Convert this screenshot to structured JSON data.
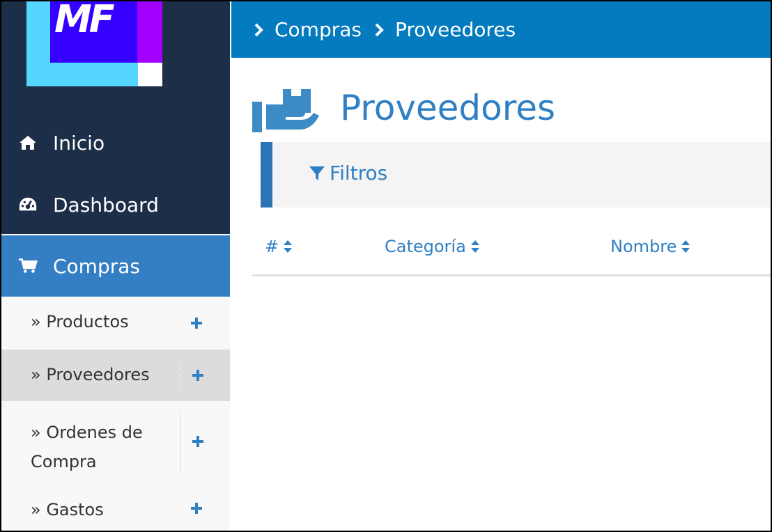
{
  "logo": {
    "text": "MF"
  },
  "sidebar": {
    "nav": [
      {
        "label": "Inicio",
        "icon": "home-icon"
      },
      {
        "label": "Dashboard",
        "icon": "dashboard-icon"
      },
      {
        "label": "Compras",
        "icon": "shopping-cart-icon",
        "active": true
      }
    ],
    "sub_items": [
      {
        "label": "» Productos",
        "action_icon": "plus-icon"
      },
      {
        "label": "» Proveedores",
        "action_icon": "plus-icon",
        "selected": true
      },
      {
        "label": "» Ordenes de Compra",
        "action_icon": "plus-icon"
      },
      {
        "label": "» Gastos",
        "action_icon": "plus-icon"
      }
    ]
  },
  "breadcrumb": {
    "items": [
      "Compras",
      "Proveedores"
    ],
    "icon": "chevron-right-icon"
  },
  "page": {
    "title": "Proveedores",
    "icon": "hand-holding-box-icon"
  },
  "filters": {
    "label": "Filtros",
    "icon": "filter-icon"
  },
  "table": {
    "columns": [
      {
        "label": "#",
        "sort_icon": "sort-icon"
      },
      {
        "label": "Categoría",
        "sort_icon": "sort-icon"
      },
      {
        "label": "Nombre",
        "sort_icon": "sort-icon"
      }
    ]
  },
  "colors": {
    "sidebar_dark": "#1c2e48",
    "active_nav": "#347ec4",
    "topbar": "#047bbf",
    "accent_text": "#2e7fc4",
    "selected_sub": "#dcdcdc"
  }
}
